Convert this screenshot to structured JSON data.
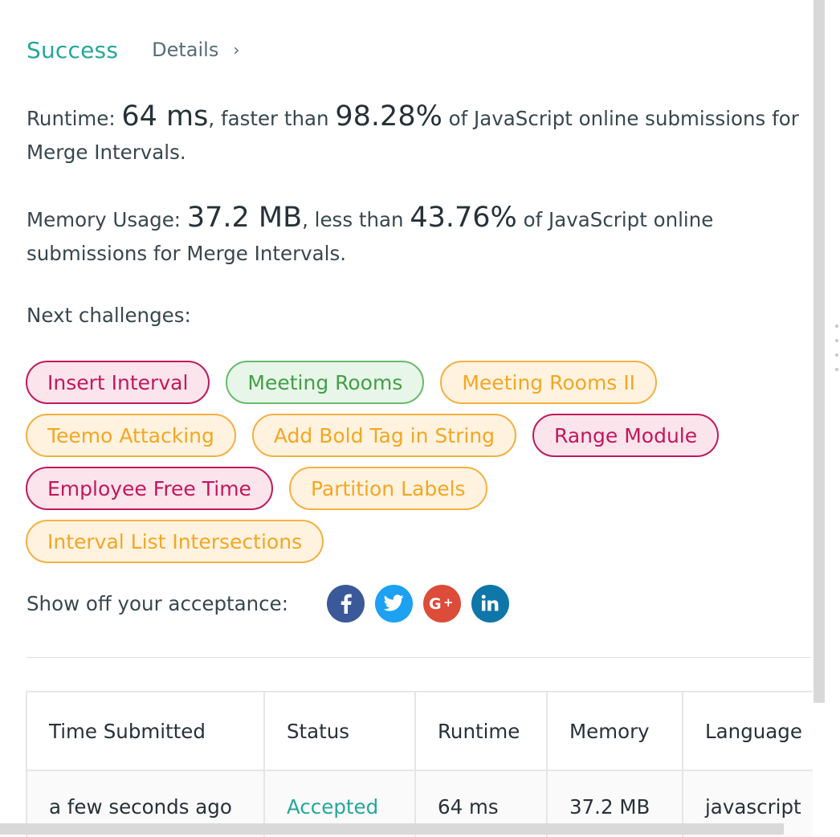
{
  "header": {
    "status": "Success",
    "details_label": "Details",
    "details_chevron": "›"
  },
  "runtime": {
    "label": "Runtime:",
    "value": "64 ms",
    "mid": ", faster than",
    "percent": "98.28%",
    "suffix": "of JavaScript online submissions for Merge Intervals."
  },
  "memory": {
    "label": "Memory Usage:",
    "value": "37.2 MB",
    "mid": ", less than",
    "percent": "43.76%",
    "suffix": "of JavaScript online submissions for Merge Intervals."
  },
  "next": {
    "label": "Next challenges:",
    "tags": [
      {
        "label": "Insert Interval",
        "difficulty": "hard"
      },
      {
        "label": "Meeting Rooms",
        "difficulty": "easy"
      },
      {
        "label": "Meeting Rooms II",
        "difficulty": "medium"
      },
      {
        "label": "Teemo Attacking",
        "difficulty": "medium"
      },
      {
        "label": "Add Bold Tag in String",
        "difficulty": "medium"
      },
      {
        "label": "Range Module",
        "difficulty": "hard"
      },
      {
        "label": "Employee Free Time",
        "difficulty": "hard"
      },
      {
        "label": "Partition Labels",
        "difficulty": "medium"
      },
      {
        "label": "Interval List Intersections",
        "difficulty": "medium"
      }
    ]
  },
  "share": {
    "label": "Show off your acceptance:",
    "buttons": [
      {
        "icon": "facebook-icon",
        "color": "#3b5998"
      },
      {
        "icon": "twitter-icon",
        "color": "#1da1f2"
      },
      {
        "icon": "google-plus-icon",
        "color": "#dd4b39"
      },
      {
        "icon": "linkedin-icon",
        "color": "#0e76a8"
      }
    ]
  },
  "table": {
    "headers": [
      "Time Submitted",
      "Status",
      "Runtime",
      "Memory",
      "Language"
    ],
    "rows": [
      [
        "a few seconds ago",
        "Accepted",
        "64 ms",
        "37.2 MB",
        "javascript"
      ]
    ]
  },
  "colors": {
    "success": "#26a69a",
    "hard": "#c2185b",
    "easy": "#43a047",
    "medium": "#f5a623"
  }
}
